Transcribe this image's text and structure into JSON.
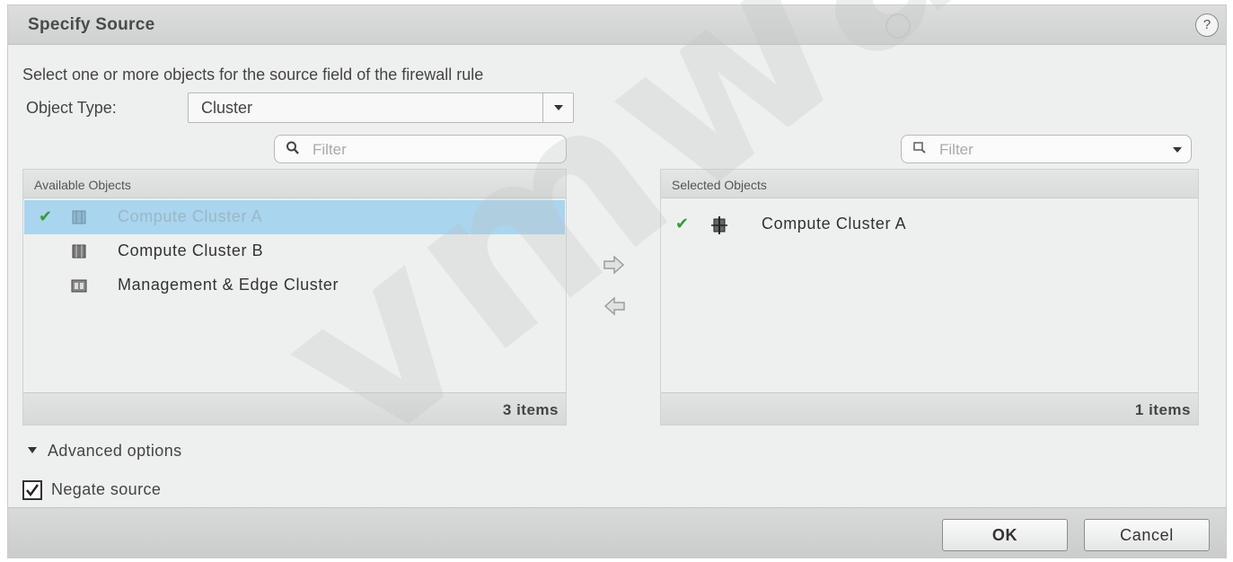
{
  "dialog": {
    "title": "Specify Source",
    "help_label": "?"
  },
  "instruction": "Select one or more objects for the source field of the firewall rule",
  "object_type": {
    "label": "Object Type:",
    "value": "Cluster"
  },
  "filters": {
    "available_placeholder": "Filter",
    "selected_placeholder": "Filter"
  },
  "available": {
    "header": "Available Objects",
    "items": [
      {
        "label": "Compute Cluster A",
        "checked": true,
        "highlighted": true,
        "icon": "cluster-icon"
      },
      {
        "label": "Compute Cluster B",
        "checked": false,
        "highlighted": false,
        "icon": "cluster-icon"
      },
      {
        "label": "Management & Edge Cluster",
        "checked": false,
        "highlighted": false,
        "icon": "cluster-icon"
      }
    ],
    "count_label": "3 items"
  },
  "selected": {
    "header": "Selected Objects",
    "items": [
      {
        "label": "Compute Cluster A",
        "checked": true,
        "icon": "cluster-icon"
      }
    ],
    "count_label": "1 items"
  },
  "advanced_options": "Advanced options",
  "negate": {
    "label": "Negate source",
    "checked": true
  },
  "buttons": {
    "ok": "OK",
    "cancel": "Cancel"
  },
  "watermark": "vmware",
  "colors": {
    "highlight": "#a9d5ee",
    "check_green": "#3a9a3a"
  }
}
